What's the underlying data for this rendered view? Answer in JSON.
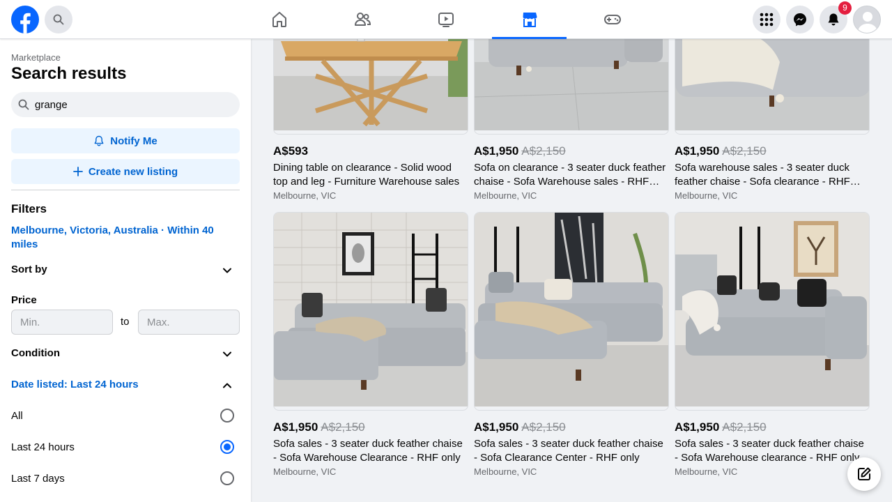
{
  "header": {
    "nav": [
      {
        "name": "home",
        "icon": "home-icon"
      },
      {
        "name": "friends",
        "icon": "friends-icon"
      },
      {
        "name": "watch",
        "icon": "video-icon"
      },
      {
        "name": "marketplace",
        "icon": "marketplace-icon",
        "active": true
      },
      {
        "name": "gaming",
        "icon": "gamepad-icon"
      }
    ],
    "notifications_count": "9"
  },
  "sidebar": {
    "breadcrumb": "Marketplace",
    "title": "Search results",
    "search_value": "grange",
    "notify_label": "Notify Me",
    "create_label": "Create new listing",
    "filters_title": "Filters",
    "location": "Melbourne, Victoria, Australia · Within 40 miles",
    "sort_label": "Sort by",
    "price_label": "Price",
    "price_min_placeholder": "Min.",
    "price_to": "to",
    "price_max_placeholder": "Max.",
    "condition_label": "Condition",
    "date_listed_label": "Date listed: Last 24 hours",
    "date_options": [
      {
        "label": "All",
        "checked": false
      },
      {
        "label": "Last 24 hours",
        "checked": true
      },
      {
        "label": "Last 7 days",
        "checked": false
      }
    ]
  },
  "listings": [
    {
      "price": "A$593",
      "old_price": "",
      "title": "Dining table on clearance - Solid wood top and leg - Furniture Warehouse sales",
      "location": "Melbourne, VIC"
    },
    {
      "price": "A$1,950",
      "old_price": "A$2,150",
      "title": "Sofa on clearance - 3 seater duck feather chaise - Sofa Warehouse sales - RHF only",
      "location": "Melbourne, VIC"
    },
    {
      "price": "A$1,950",
      "old_price": "A$2,150",
      "title": "Sofa warehouse sales - 3 seater duck feather chaise - Sofa clearance - RHF only",
      "location": "Melbourne, VIC"
    },
    {
      "price": "A$1,950",
      "old_price": "A$2,150",
      "title": "Sofa sales - 3 seater duck feather chaise - Sofa Warehouse Clearance - RHF only",
      "location": "Melbourne, VIC"
    },
    {
      "price": "A$1,950",
      "old_price": "A$2,150",
      "title": "Sofa sales - 3 seater duck feather chaise - Sofa Clearance Center - RHF only",
      "location": "Melbourne, VIC"
    },
    {
      "price": "A$1,950",
      "old_price": "A$2,150",
      "title": "Sofa sales - 3 seater duck feather chaise - Sofa Warehouse clearance - RHF only",
      "location": "Melbourne, VIC"
    }
  ],
  "colors": {
    "brand": "#0866ff",
    "link": "#0064d1",
    "badge": "#e41e3f"
  }
}
